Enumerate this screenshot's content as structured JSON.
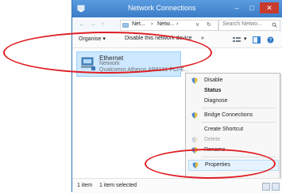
{
  "window": {
    "title": "Network Connections",
    "buttons": {
      "minimize": "–",
      "maximize": "□",
      "close": "✕"
    }
  },
  "addressbar": {
    "back": "←",
    "forward": "→",
    "up": "↑",
    "crumbs": [
      "Net...",
      "Netw..."
    ],
    "search_placeholder": "Search Netwo...",
    "search_icon": "search-icon"
  },
  "toolbar": {
    "organise": "Organise ▾",
    "disable_device": "Disable this network device",
    "more": "»"
  },
  "network_item": {
    "name": "Ethernet",
    "status": "Network",
    "adapter": "Qualcomm Atheros AR8131 PCI-E..."
  },
  "context_menu": {
    "items": [
      {
        "label": "Disable",
        "icon": "shield-icon",
        "disabled": false
      },
      {
        "label": "Status",
        "bold": true,
        "disabled": false
      },
      {
        "label": "Diagnose",
        "disabled": false
      },
      {
        "label": "Bridge Connections",
        "icon": "shield-icon",
        "disabled": false
      },
      {
        "label": "Create Shortcut",
        "disabled": false
      },
      {
        "label": "Delete",
        "icon": "shield-icon",
        "disabled": true
      },
      {
        "label": "Rename",
        "icon": "shield-icon",
        "disabled": false
      },
      {
        "label": "Properties",
        "icon": "shield-icon",
        "disabled": false,
        "highlighted": true
      }
    ]
  },
  "statusbar": {
    "count": "1 item",
    "selected": "1 item selected"
  },
  "colors": {
    "titlebar": "#3b7ec7",
    "selection": "#cde8ff",
    "annotation": "#e01e24"
  }
}
